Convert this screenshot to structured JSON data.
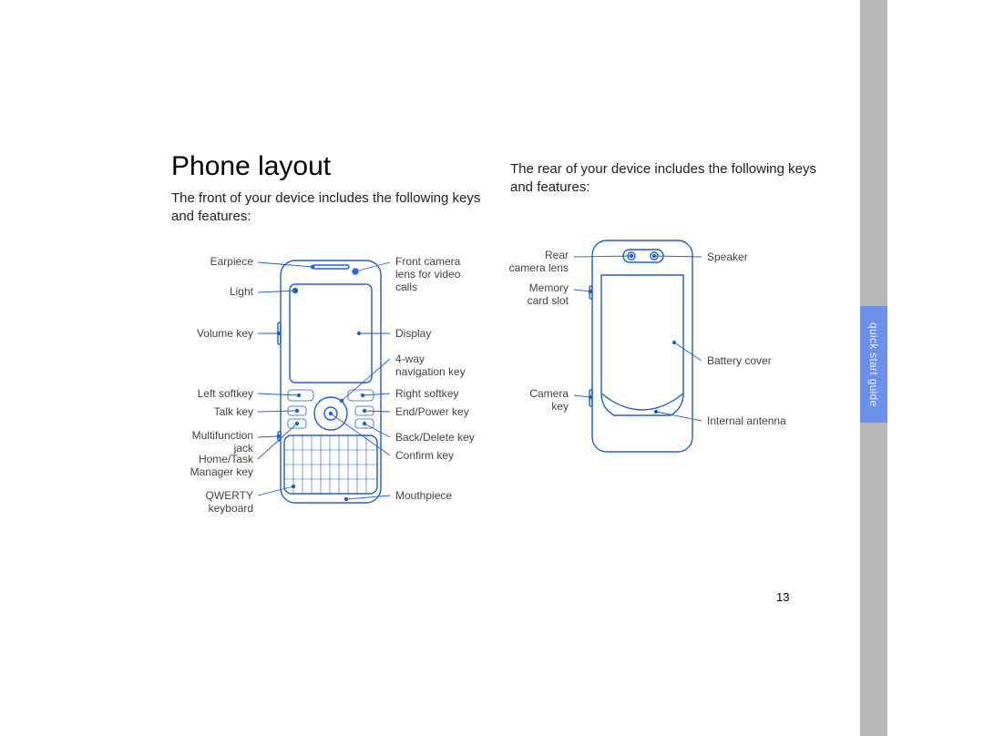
{
  "page_number": "13",
  "section_title": "Phone layout",
  "front_intro": "The front of your device includes the following keys and features:",
  "rear_intro": "The rear of your device includes the following keys and features:",
  "sidebar_tab": "quick start guide",
  "front_labels": {
    "earpiece": "Earpiece",
    "light": "Light",
    "volume_key": "Volume key",
    "left_softkey": "Left softkey",
    "talk_key": "Talk key",
    "multifunction_jack_1": "Multifunction",
    "multifunction_jack_2": "jack",
    "home_task_1": "Home/Task",
    "home_task_2": "Manager key",
    "qwerty_1": "QWERTY",
    "qwerty_2": "keyboard",
    "front_camera_1": "Front camera",
    "front_camera_2": "lens for video",
    "front_camera_3": "calls",
    "display": "Display",
    "fourway_1": "4-way",
    "fourway_2": "navigation key",
    "right_softkey": "Right softkey",
    "end_power": "End/Power key",
    "back_delete": "Back/Delete key",
    "confirm": "Confirm key",
    "mouthpiece": "Mouthpiece"
  },
  "rear_labels": {
    "rear_camera_1": "Rear",
    "rear_camera_2": "camera lens",
    "memory_1": "Memory",
    "memory_2": "card slot",
    "camera_key_1": "Camera",
    "camera_key_2": "key",
    "speaker": "Speaker",
    "battery_cover": "Battery cover",
    "internal_antenna": "Internal antenna"
  }
}
